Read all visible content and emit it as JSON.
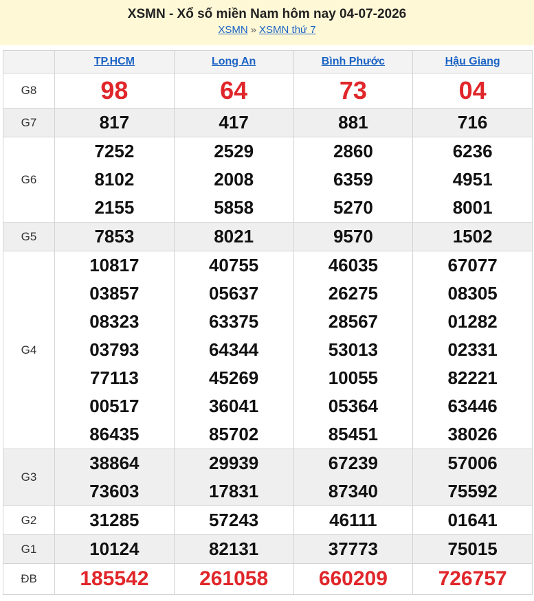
{
  "header": {
    "title": "XSMN - Xổ số miền Nam hôm nay 04-07-2026",
    "breadcrumb": {
      "link1": "XSMN",
      "separator": "»",
      "link2": "XSMN thứ 7"
    }
  },
  "colors": {
    "header_bg": "#fff8d7",
    "link": "#1a63c4",
    "highlight": "#e0262a",
    "alt_row": "#efefef"
  },
  "provinces": [
    "TP.HCM",
    "Long An",
    "Bình Phước",
    "Hậu Giang"
  ],
  "prizes": [
    {
      "label": "G8",
      "style": "big",
      "alt": false,
      "values": [
        [
          "98"
        ],
        [
          "64"
        ],
        [
          "73"
        ],
        [
          "04"
        ]
      ]
    },
    {
      "label": "G7",
      "style": "normal",
      "alt": true,
      "values": [
        [
          "817"
        ],
        [
          "417"
        ],
        [
          "881"
        ],
        [
          "716"
        ]
      ]
    },
    {
      "label": "G6",
      "style": "normal",
      "alt": false,
      "values": [
        [
          "7252",
          "8102",
          "2155"
        ],
        [
          "2529",
          "2008",
          "5858"
        ],
        [
          "2860",
          "6359",
          "5270"
        ],
        [
          "6236",
          "4951",
          "8001"
        ]
      ]
    },
    {
      "label": "G5",
      "style": "normal",
      "alt": true,
      "values": [
        [
          "7853"
        ],
        [
          "8021"
        ],
        [
          "9570"
        ],
        [
          "1502"
        ]
      ]
    },
    {
      "label": "G4",
      "style": "normal",
      "alt": false,
      "values": [
        [
          "10817",
          "03857",
          "08323",
          "03793",
          "77113",
          "00517",
          "86435"
        ],
        [
          "40755",
          "05637",
          "63375",
          "64344",
          "45269",
          "36041",
          "85702"
        ],
        [
          "46035",
          "26275",
          "28567",
          "53013",
          "10055",
          "05364",
          "85451"
        ],
        [
          "67077",
          "08305",
          "01282",
          "02331",
          "82221",
          "63446",
          "38026"
        ]
      ]
    },
    {
      "label": "G3",
      "style": "normal",
      "alt": true,
      "values": [
        [
          "38864",
          "73603"
        ],
        [
          "29939",
          "17831"
        ],
        [
          "67239",
          "87340"
        ],
        [
          "57006",
          "75592"
        ]
      ]
    },
    {
      "label": "G2",
      "style": "normal",
      "alt": false,
      "values": [
        [
          "31285"
        ],
        [
          "57243"
        ],
        [
          "46111"
        ],
        [
          "01641"
        ]
      ]
    },
    {
      "label": "G1",
      "style": "normal",
      "alt": true,
      "values": [
        [
          "10124"
        ],
        [
          "82131"
        ],
        [
          "37773"
        ],
        [
          "75015"
        ]
      ]
    },
    {
      "label": "ĐB",
      "style": "special",
      "alt": false,
      "values": [
        [
          "185542"
        ],
        [
          "261058"
        ],
        [
          "660209"
        ],
        [
          "726757"
        ]
      ]
    }
  ]
}
